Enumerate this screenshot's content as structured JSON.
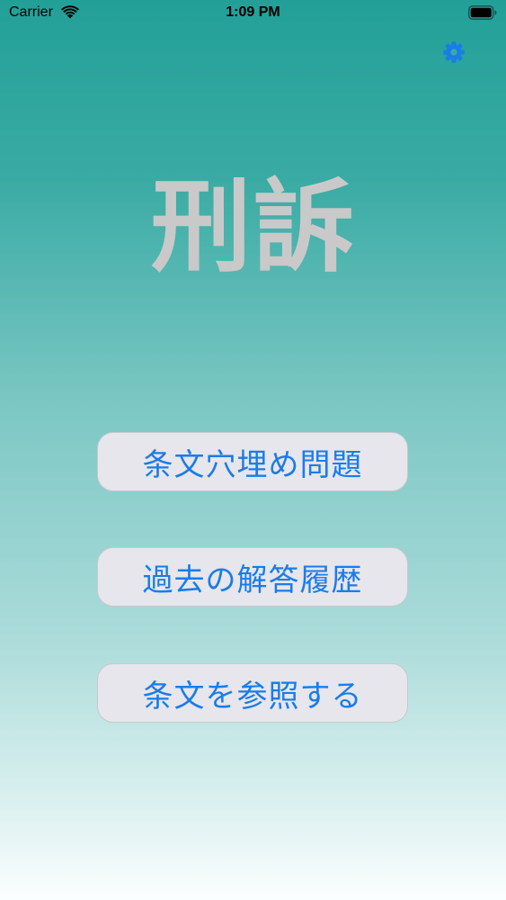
{
  "status_bar": {
    "carrier": "Carrier",
    "time": "1:09 PM"
  },
  "icons": {
    "wifi": "wifi-icon",
    "battery": "battery-icon",
    "settings": "gear-icon"
  },
  "title": "刑訴",
  "menu": {
    "fill_blank_quiz": "条文穴埋め問題",
    "answer_history": "過去の解答履歴",
    "browse_articles": "条文を参照する"
  },
  "colors": {
    "accent": "#1a7ce8",
    "gradient_top": "#22a098",
    "gradient_bottom": "#fbfefe",
    "title": "#c9c9c9",
    "button_bg": "#e6e6ec"
  }
}
